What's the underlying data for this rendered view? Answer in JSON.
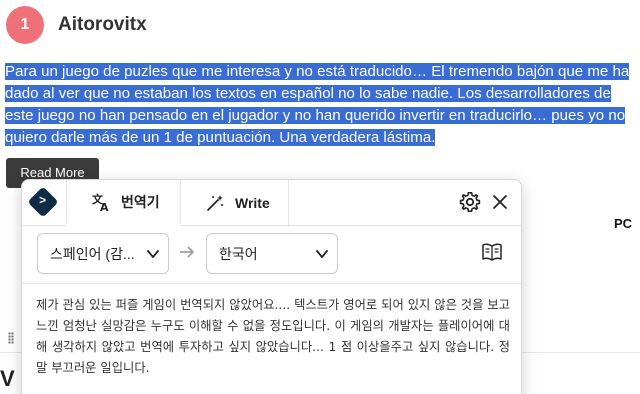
{
  "review": {
    "rank": "1",
    "reviewer": "Aitorovitx",
    "text": "Para un juego de puzles que me interesa y no está traducido… El tremendo bajón que me ha dado al ver que no estaban los textos en español no lo sabe nadie. Los desarrolladores de este juego no han pensado en el jugador y no han querido invertir en traducirlo… pues yo no quiero darle más de un 1 de puntuación. Una verdadera lástima.",
    "read_more_label": "Read More"
  },
  "page": {
    "side_label": "PC",
    "edge_glyph": "V"
  },
  "translator": {
    "tabs": [
      {
        "label": "번역기",
        "icon": "translate-icon"
      },
      {
        "label": "Write",
        "icon": "magic-wand-icon"
      }
    ],
    "source_language": "스페인어 (감...",
    "target_language": "한국어",
    "translation": "제가 관심 있는 퍼즐 게임이 번역되지 않았어요.... 텍스트가 영어로 되어 있지 않은 것을 보고 느낀 엄청난 실망감은 누구도 이해할 수 없을 정도입니다. 이 게임의 개발자는 플레이어에 대해 생각하지 않았고 번역에 투자하고 싶지 않았습니다... 1 점 이상을주고 싶지 않습니다. 정말 부끄러운 일입니다.",
    "colors": {
      "logo": "#0f2b46",
      "selection": "#3a6dd4",
      "badge": "#f0707a"
    }
  }
}
